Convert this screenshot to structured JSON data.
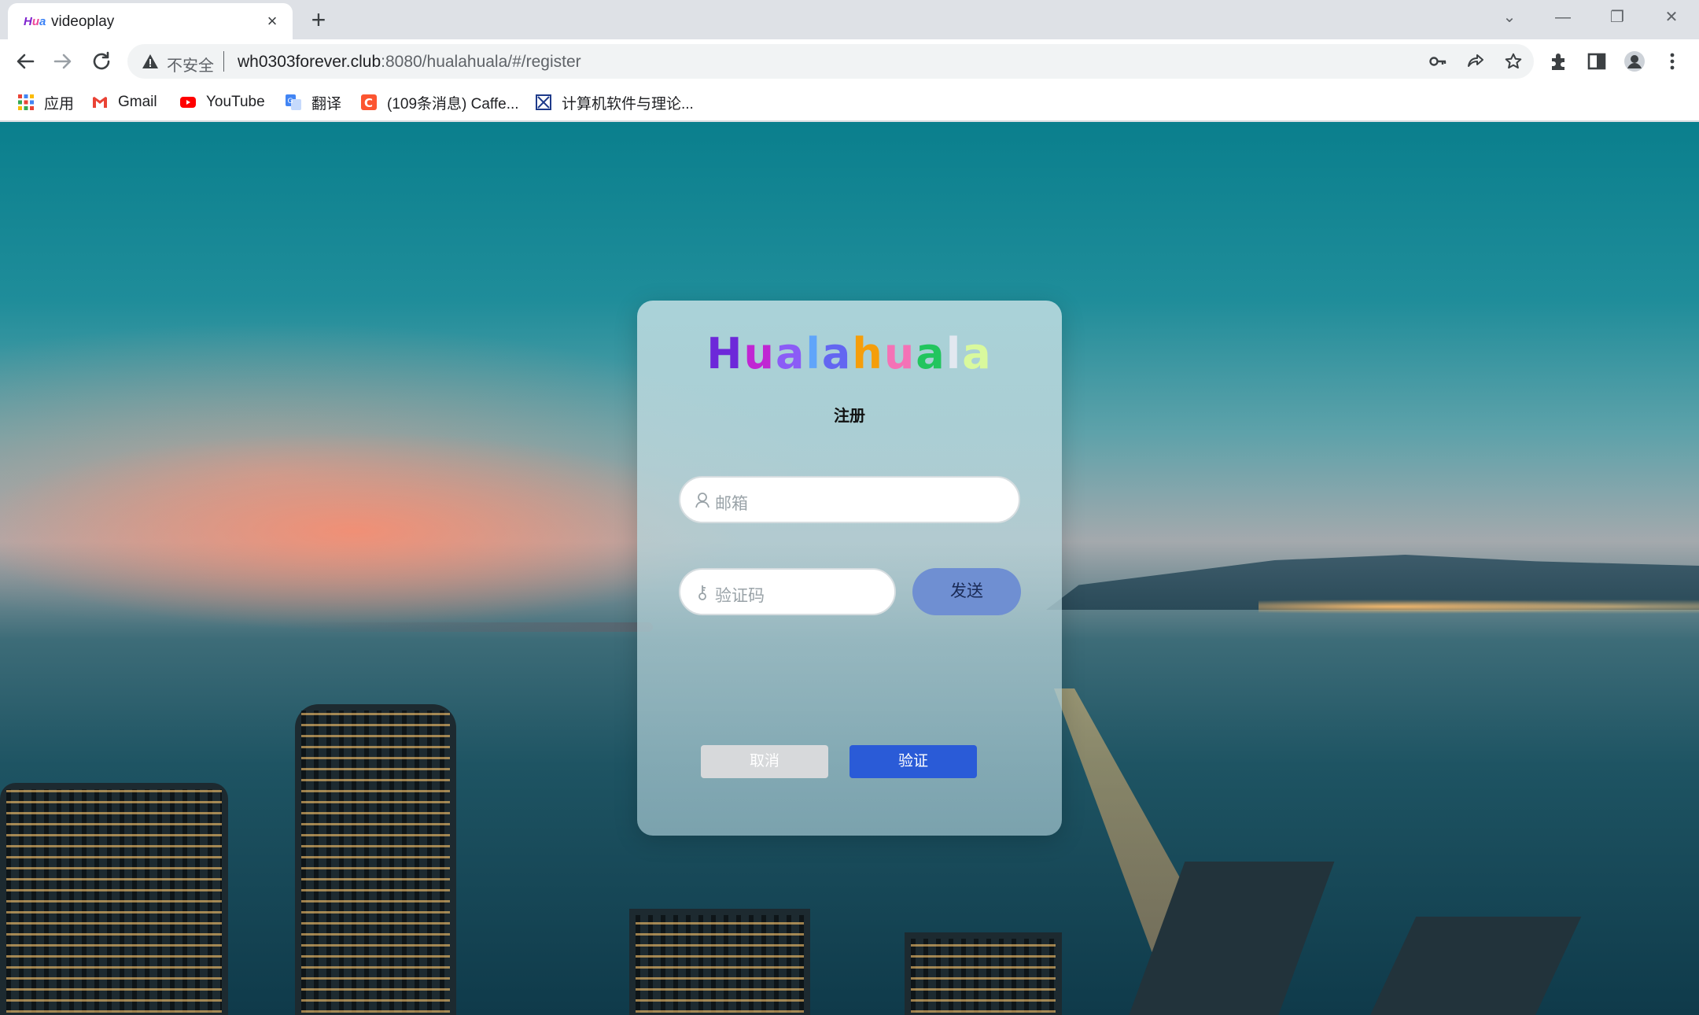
{
  "browser": {
    "tab": {
      "favicon_text": "Hua",
      "title": "videoplay",
      "close_glyph": "×"
    },
    "new_tab_glyph": "+",
    "window_controls": [
      "⌄",
      "—",
      "❐",
      "✕"
    ],
    "address": {
      "security_label": "不安全",
      "url_host": "wh0303forever.club",
      "url_rest": ":8080/hualahuala/#/register"
    },
    "bookmarks": [
      {
        "label": "应用",
        "icon": "apps-grid-icon"
      },
      {
        "label": "Gmail",
        "icon": "gmail-icon"
      },
      {
        "label": "YouTube",
        "icon": "youtube-icon"
      },
      {
        "label": "翻译",
        "icon": "translate-icon"
      },
      {
        "label": "(109条消息) Caffe...",
        "icon": "csdn-icon"
      },
      {
        "label": "计算机软件与理论...",
        "icon": "university-icon"
      }
    ]
  },
  "register": {
    "logo_letters": [
      {
        "ch": "H",
        "color": "#6d28d9"
      },
      {
        "ch": "u",
        "color": "#c026d3"
      },
      {
        "ch": "a",
        "color": "#8b5cf6"
      },
      {
        "ch": "l",
        "color": "#60a5fa"
      },
      {
        "ch": "a",
        "color": "#6366f1"
      },
      {
        "ch": "h",
        "color": "#f59e0b"
      },
      {
        "ch": "u",
        "color": "#f472b6"
      },
      {
        "ch": "a",
        "color": "#22c55e"
      },
      {
        "ch": "l",
        "color": "#e2e8f0"
      },
      {
        "ch": "a",
        "color": "#d9f99d"
      }
    ],
    "title": "注册",
    "email_placeholder": "邮箱",
    "code_placeholder": "验证码",
    "send_label": "发送",
    "cancel_label": "取消",
    "verify_label": "验证"
  }
}
